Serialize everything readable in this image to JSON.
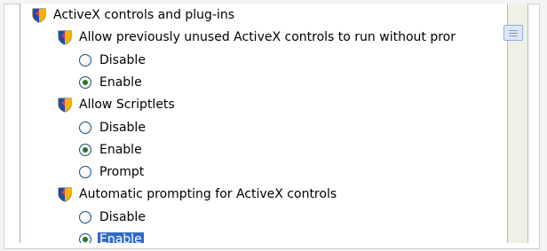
{
  "settings": {
    "section_title": "ActiveX controls and plug-ins",
    "groups": [
      {
        "title": "Allow previously unused ActiveX controls to run without pror",
        "options": [
          {
            "label": "Disable",
            "checked": false,
            "selected": false
          },
          {
            "label": "Enable",
            "checked": true,
            "selected": false
          }
        ]
      },
      {
        "title": "Allow Scriptlets",
        "options": [
          {
            "label": "Disable",
            "checked": false,
            "selected": false
          },
          {
            "label": "Enable",
            "checked": true,
            "selected": false
          },
          {
            "label": "Prompt",
            "checked": false,
            "selected": false
          }
        ]
      },
      {
        "title": "Automatic prompting for ActiveX controls",
        "options": [
          {
            "label": "Disable",
            "checked": false,
            "selected": false
          },
          {
            "label": "Enable",
            "checked": true,
            "selected": true
          }
        ]
      }
    ]
  }
}
